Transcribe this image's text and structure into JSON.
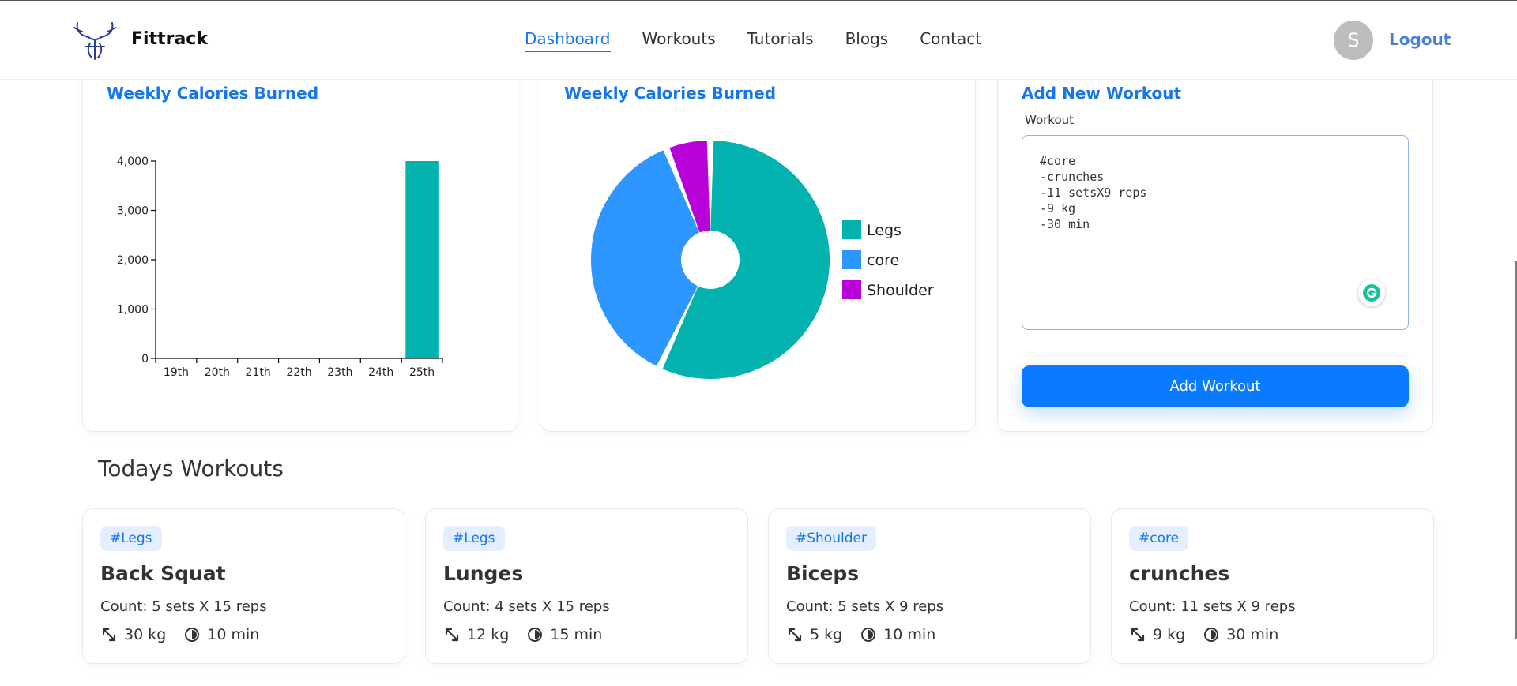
{
  "header": {
    "brand": "Fittrack",
    "nav": [
      "Dashboard",
      "Workouts",
      "Tutorials",
      "Blogs",
      "Contact"
    ],
    "active_nav": "Dashboard",
    "avatar_initial": "S",
    "logout": "Logout"
  },
  "bar_card": {
    "title": "Weekly Calories Burned"
  },
  "pie_card": {
    "title": "Weekly Calories Burned"
  },
  "add_card": {
    "title": "Add New Workout",
    "field_label": "Workout",
    "textarea_value": "#core\n-crunches\n-11 setsX9 reps\n-9 kg\n-30 min",
    "button": "Add Workout"
  },
  "todays": {
    "title": "Todays Workouts",
    "items": [
      {
        "tag": "#Legs",
        "name": "Back Squat",
        "count": "Count: 5 sets X 15 reps",
        "weight": "30 kg",
        "duration": "10 min"
      },
      {
        "tag": "#Legs",
        "name": "Lunges",
        "count": "Count: 4 sets X 15 reps",
        "weight": "12 kg",
        "duration": "15 min"
      },
      {
        "tag": "#Shoulder",
        "name": "Biceps",
        "count": "Count: 5 sets X 9 reps",
        "weight": "5 kg",
        "duration": "10 min"
      },
      {
        "tag": "#core",
        "name": "crunches",
        "count": "Count: 11 sets X 9 reps",
        "weight": "9 kg",
        "duration": "30 min"
      }
    ]
  },
  "colors": {
    "accent": "#1677e8",
    "teal": "#02b2af",
    "blue": "#2e96ff",
    "purple": "#b800d8"
  },
  "chart_data": [
    {
      "type": "bar",
      "title": "Weekly Calories Burned",
      "categories": [
        "19th",
        "20th",
        "21th",
        "22th",
        "23th",
        "24th",
        "25th"
      ],
      "values": [
        0,
        0,
        0,
        0,
        0,
        0,
        4000
      ],
      "yticks": [
        "0",
        "1,000",
        "2,000",
        "3,000",
        "4,000"
      ],
      "ylim": [
        0,
        4000
      ],
      "color": "#02b2af"
    },
    {
      "type": "pie",
      "title": "Weekly Calories Burned",
      "slices": [
        {
          "label": "Legs",
          "value": 57,
          "color": "#02b2af"
        },
        {
          "label": "core",
          "value": 37,
          "color": "#2e96ff"
        },
        {
          "label": "Shoulder",
          "value": 6,
          "color": "#b800d8"
        }
      ],
      "legend": "right"
    }
  ]
}
